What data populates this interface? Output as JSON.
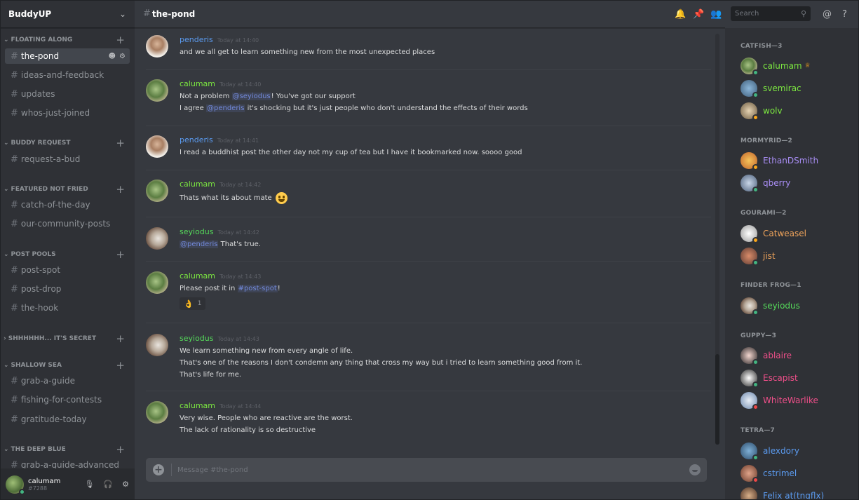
{
  "server": {
    "name": "BuddyUP"
  },
  "sidebar": {
    "categories": [
      {
        "name": "FLOATING ALONG",
        "channels": [
          "the-pond",
          "ideas-and-feedback",
          "updates",
          "whos-just-joined"
        ]
      },
      {
        "name": "BUDDY REQUEST",
        "channels": [
          "request-a-bud"
        ]
      },
      {
        "name": "FEATURED NOT FRIED",
        "channels": [
          "catch-of-the-day",
          "our-community-posts"
        ]
      },
      {
        "name": "POST POOLS",
        "channels": [
          "post-spot",
          "post-drop",
          "the-hook"
        ]
      },
      {
        "name": "SHHHHHH... IT'S SECRET",
        "channels": []
      },
      {
        "name": "SHALLOW SEA",
        "channels": [
          "grab-a-guide",
          "fishing-for-contests",
          "gratitude-today"
        ]
      },
      {
        "name": "THE DEEP BLUE",
        "channels": [
          "grab-a-guide-advanced"
        ]
      }
    ]
  },
  "user": {
    "name": "calumam",
    "tag": "#7288"
  },
  "channel": {
    "name": "the-pond"
  },
  "search": {
    "placeholder": "Search"
  },
  "composer": {
    "placeholder": "Message #the-pond"
  },
  "messages": [
    {
      "author": "penderis",
      "color": "#5b9bf0",
      "time": "Today at 14:40",
      "lines": [
        "and we all get to learn something new from the most unexpected places"
      ]
    },
    {
      "author": "calumam",
      "color": "#7ce840",
      "time": "Today at 14:40",
      "l1_pre": "Not a problem ",
      "l1_mention": "@seyiodus",
      "l1_post": "! You've got our support",
      "l2_pre": "I agree ",
      "l2_mention": "@penderis",
      "l2_post": " it's shocking but it's just people who don't understand the effects of their words"
    },
    {
      "author": "penderis",
      "color": "#5b9bf0",
      "time": "Today at 14:41",
      "lines": [
        "I read a buddhist post the other day not my cup of tea but I have it bookmarked now. soooo good"
      ]
    },
    {
      "author": "calumam",
      "color": "#7ce840",
      "time": "Today at 14:42",
      "lines": [
        "Thats what its about mate"
      ]
    },
    {
      "author": "seyiodus",
      "color": "#55d95a",
      "time": "Today at 14:42",
      "mention": "@penderis",
      "post": " That's true."
    },
    {
      "author": "calumam",
      "color": "#7ce840",
      "time": "Today at 14:43",
      "pre": "Please post it in ",
      "mention": "#post-spot",
      "post": "!",
      "reaction": {
        "emoji": "👌",
        "count": "1"
      }
    },
    {
      "author": "seyiodus",
      "color": "#55d95a",
      "time": "Today at 14:43",
      "lines": [
        "We learn something new from every angle of life.",
        "That's one of the reasons I don't condemn any thing that cross my way but i tried to learn something good from it.",
        "That's life for me."
      ]
    },
    {
      "author": "calumam",
      "color": "#7ce840",
      "time": "Today at 14:44",
      "lines": [
        "Very wise. People who are reactive are the worst.",
        "The lack of rationality is so destructive"
      ]
    }
  ],
  "members": {
    "groups": [
      {
        "role": "CATFISH—3",
        "members": [
          {
            "name": "calumam",
            "color": "#7ce840",
            "status": "#43b581"
          },
          {
            "name": "svemirac",
            "color": "#7ce840",
            "status": "#43b581"
          },
          {
            "name": "wolv",
            "color": "#7ce840",
            "status": "#faa61a"
          }
        ]
      },
      {
        "role": "MORMYRID—2",
        "members": [
          {
            "name": "EthanDSmith",
            "color": "#a98ef5",
            "status": "#faa61a"
          },
          {
            "name": "qberry",
            "color": "#a98ef5",
            "status": "#43b581"
          }
        ]
      },
      {
        "role": "GOURAMI—2",
        "members": [
          {
            "name": "Catweasel",
            "color": "#f0a45b",
            "status": "#faa61a"
          },
          {
            "name": "jist",
            "color": "#f0a45b",
            "status": "#43b581"
          }
        ]
      },
      {
        "role": "FINDER FROG—1",
        "members": [
          {
            "name": "seyiodus",
            "color": "#55d95a",
            "status": "#43b581"
          }
        ]
      },
      {
        "role": "GUPPY—3",
        "members": [
          {
            "name": "ablaire",
            "color": "#f04f8a",
            "status": "#43b581"
          },
          {
            "name": "Escapist",
            "color": "#f04f8a",
            "status": "#43b581"
          },
          {
            "name": "WhiteWarlike",
            "color": "#f04f8a",
            "status": "#f04747"
          }
        ]
      },
      {
        "role": "TETRA—7",
        "members": [
          {
            "name": "alexdory",
            "color": "#5b9bf0",
            "status": "#43b581"
          },
          {
            "name": "cstrimel",
            "color": "#5b9bf0",
            "status": "#f04747"
          },
          {
            "name": "Felix at(tngflx)",
            "color": "#5b9bf0",
            "status": "#43b581"
          }
        ]
      }
    ]
  }
}
